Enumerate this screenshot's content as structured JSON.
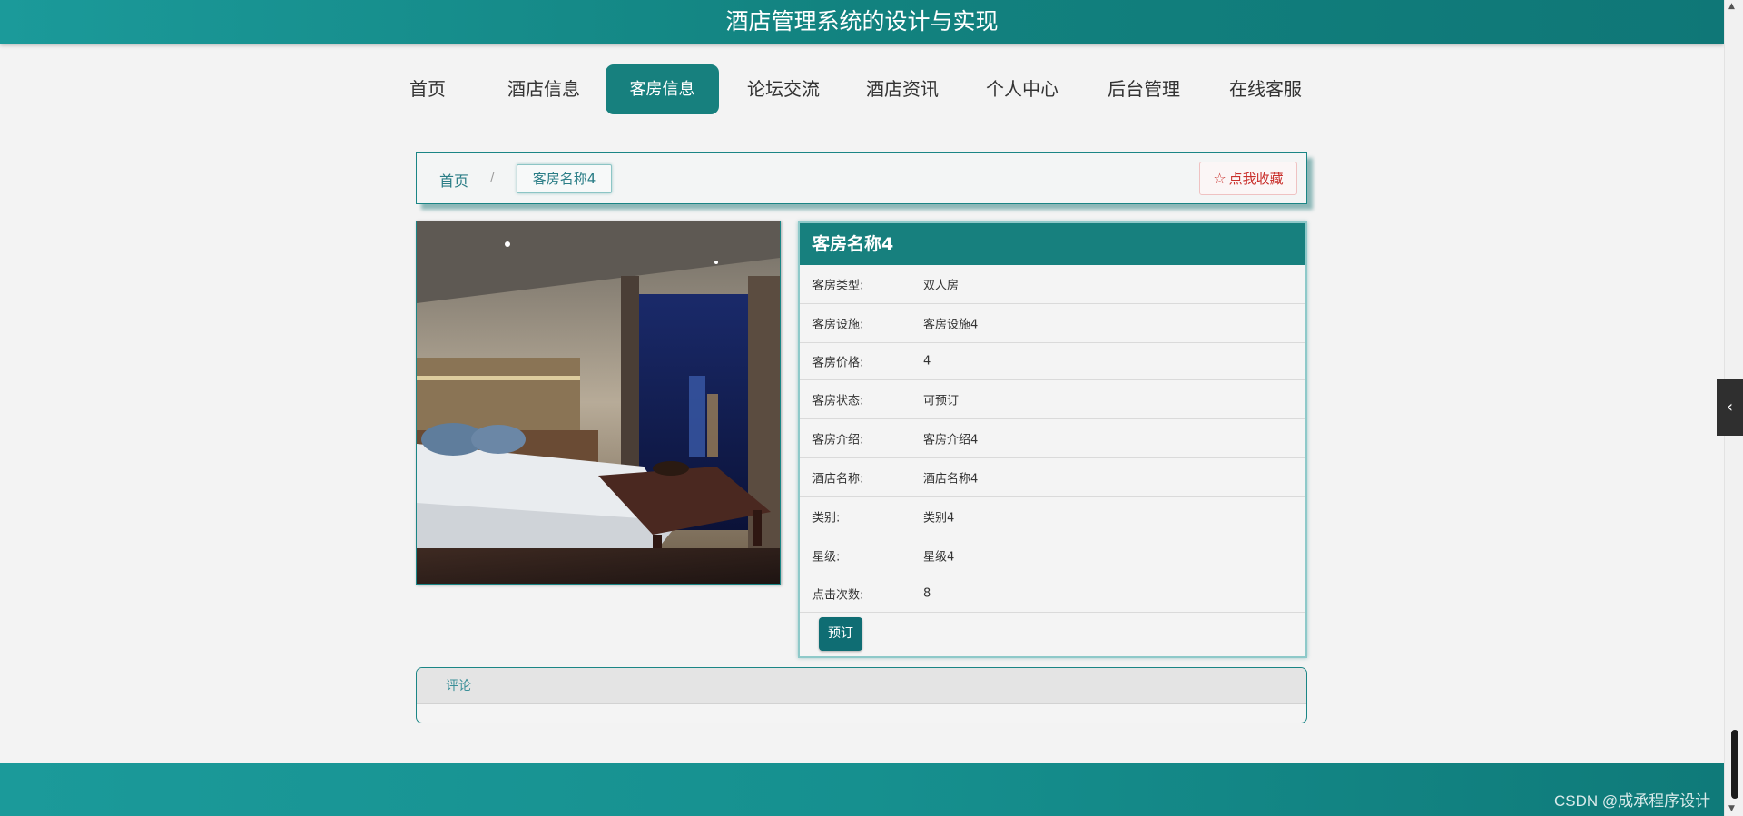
{
  "header": {
    "title": "酒店管理系统的设计与实现"
  },
  "nav": {
    "items": [
      {
        "label": "首页"
      },
      {
        "label": "酒店信息"
      },
      {
        "label": "客房信息"
      },
      {
        "label": "论坛交流"
      },
      {
        "label": "酒店资讯"
      },
      {
        "label": "个人中心"
      },
      {
        "label": "后台管理"
      },
      {
        "label": "在线客服"
      }
    ],
    "active_index": 2
  },
  "breadcrumb": {
    "home": "首页",
    "separator": "/",
    "current": "客房名称4"
  },
  "favorite": {
    "icon": "star-outline-icon",
    "label": "点我收藏"
  },
  "room": {
    "title": "客房名称4",
    "fields": [
      {
        "label": "客房类型:",
        "value": "双人房"
      },
      {
        "label": "客房设施:",
        "value": "客房设施4"
      },
      {
        "label": "客房价格:",
        "value": "4"
      },
      {
        "label": "客房状态:",
        "value": "可预订"
      },
      {
        "label": "客房介绍:",
        "value": "客房介绍4"
      },
      {
        "label": "酒店名称:",
        "value": "酒店名称4"
      },
      {
        "label": "类别:",
        "value": "类别4"
      },
      {
        "label": "星级:",
        "value": "星级4"
      },
      {
        "label": "点击次数:",
        "value": "8"
      }
    ],
    "book_label": "预订"
  },
  "comments": {
    "title": "评论"
  },
  "watermark": "CSDN @成承程序设计",
  "colors": {
    "accent": "#17807e",
    "favorite": "#c9302c"
  }
}
